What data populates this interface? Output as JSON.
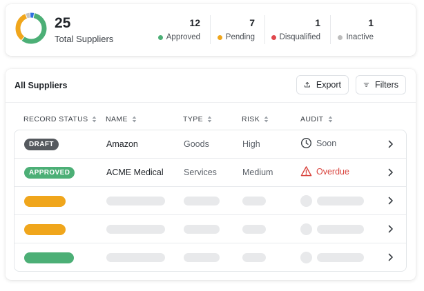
{
  "summary": {
    "total_value": "25",
    "total_label": "Total Suppliers",
    "stats": [
      {
        "value": "12",
        "label": "Approved",
        "color": "#4caf76"
      },
      {
        "value": "7",
        "label": "Pending",
        "color": "#f0a61c"
      },
      {
        "value": "1",
        "label": "Disqualified",
        "color": "#e0484d"
      },
      {
        "value": "1",
        "label": "Inactive",
        "color": "#bdbdbd"
      }
    ],
    "donut_colors": {
      "approved": "#4caf76",
      "pending": "#f0a61c",
      "disqualified": "#e0484d",
      "inactive": "#c4c4c4",
      "blue": "#2f6fe0"
    }
  },
  "table": {
    "title": "All Suppliers",
    "export_label": "Export",
    "filters_label": "Filters",
    "columns": [
      "RECORD STATUS",
      "NAME",
      "TYPE",
      "RISK",
      "AUDIT"
    ],
    "rows": [
      {
        "status": "DRAFT",
        "status_color": "#55595e",
        "name": "Amazon",
        "type": "Goods",
        "risk": "High",
        "audit": "Soon",
        "audit_icon": "clock-icon",
        "audit_color": "#5a6068"
      },
      {
        "status": "APPROVED",
        "status_color": "#4caf76",
        "name": "ACME Medical",
        "type": "Services",
        "risk": "Medium",
        "audit": "Overdue",
        "audit_icon": "warning-icon",
        "audit_color": "#d9453f"
      }
    ],
    "placeholder_badge_colors": [
      "#f0a61c",
      "#f0a61c",
      "#4caf76"
    ]
  }
}
